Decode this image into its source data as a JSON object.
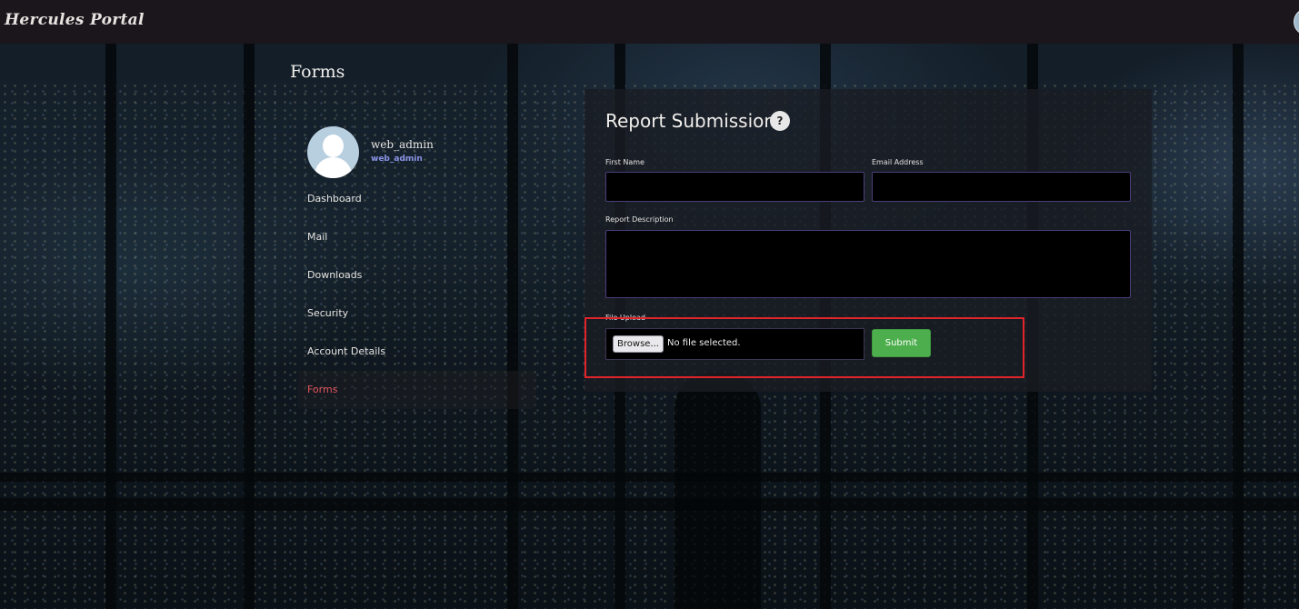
{
  "app": {
    "brand": "Hercules Portal"
  },
  "page": {
    "title": "Forms"
  },
  "profile": {
    "display_name": "web_admin",
    "username": "web_admin"
  },
  "sidebar": {
    "items": [
      {
        "label": "Dashboard",
        "active": false
      },
      {
        "label": "Mail",
        "active": false
      },
      {
        "label": "Downloads",
        "active": false
      },
      {
        "label": "Security",
        "active": false
      },
      {
        "label": "Account Details",
        "active": false
      },
      {
        "label": "Forms",
        "active": true
      }
    ]
  },
  "form": {
    "title": "Report Submission",
    "help_icon": "?",
    "first_name": {
      "label": "First Name",
      "value": ""
    },
    "email": {
      "label": "Email Address",
      "value": ""
    },
    "description": {
      "label": "Report Description",
      "value": ""
    },
    "file_upload": {
      "label": "File Upload",
      "browse_label": "Browse...",
      "status": "No file selected."
    },
    "submit_label": "Submit"
  },
  "colors": {
    "navbar_bg": "#1a161c",
    "active_nav": "#e2525c",
    "username_accent": "#8a93e6",
    "input_border": "#4a3d78",
    "submit_bg": "#4cae4c",
    "highlight": "#e0242a"
  },
  "icons": [
    "user-avatar-icon",
    "help-icon"
  ]
}
